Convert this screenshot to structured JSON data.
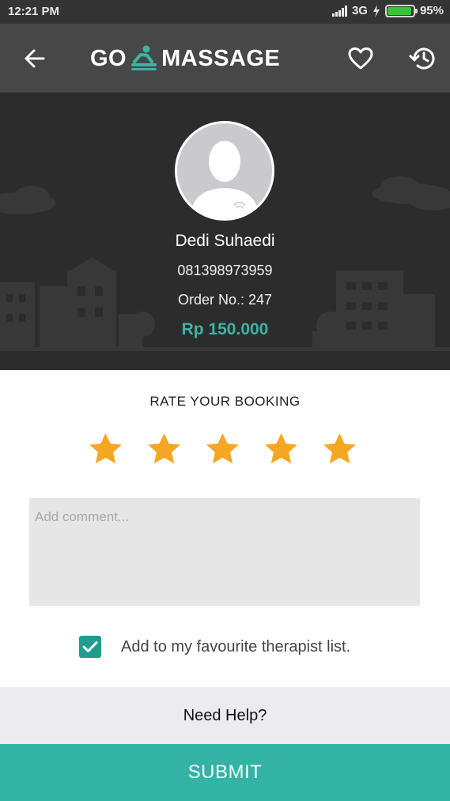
{
  "status": {
    "time": "12:21 PM",
    "network": "3G",
    "battery": "95%",
    "battery_level": 0.95
  },
  "app_bar": {
    "logo_left": "GO",
    "logo_right": "MASSAGE",
    "icons": [
      "back-arrow-icon",
      "heart-icon",
      "history-icon"
    ]
  },
  "profile": {
    "name": "Dedi Suhaedi",
    "phone": "081398973959",
    "order": "Order No.: 247",
    "price": "Rp 150.000"
  },
  "rating": {
    "title": "RATE YOUR BOOKING",
    "stars_selected": 5,
    "stars_total": 5
  },
  "comment": {
    "placeholder": "Add comment...",
    "value": ""
  },
  "favourite": {
    "checked": true,
    "label": "Add to my favourite therapist list."
  },
  "help": {
    "label": "Need Help?"
  },
  "submit": {
    "label": "SUBMIT"
  },
  "colors": {
    "accent": "#33b3a3",
    "star": "#f5a623",
    "header": "#474747",
    "profile_bg": "#2c2c2c"
  }
}
